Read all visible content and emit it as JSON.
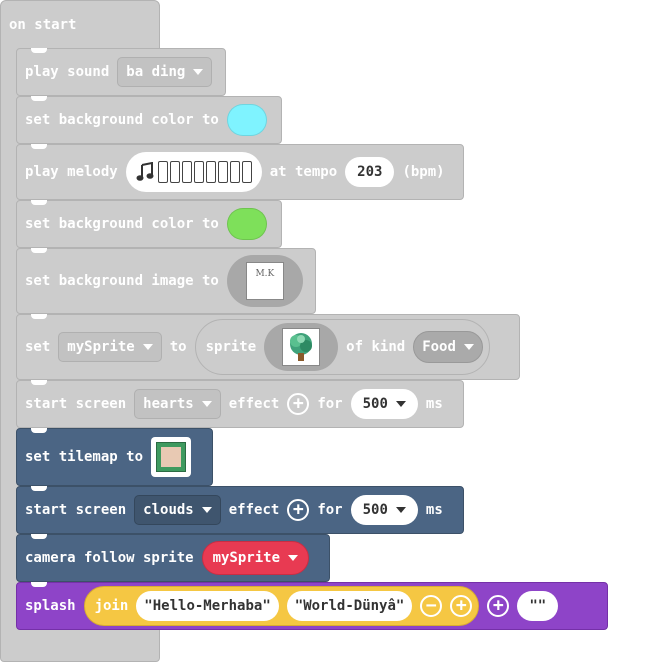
{
  "on_start": {
    "label": "on start"
  },
  "play_sound": {
    "label": "play sound",
    "sound": "ba ding"
  },
  "bg_color_1": {
    "label": "set background color to",
    "color": "#7ff3ff"
  },
  "play_melody": {
    "label": "play melody",
    "at_tempo": "at tempo",
    "tempo": "203",
    "unit": "(bpm)",
    "note_icon": "music-note-icon"
  },
  "bg_color_2": {
    "label": "set background color to",
    "color": "#7ee05a"
  },
  "bg_image": {
    "label": "set background image to",
    "thumb_text": "M.K"
  },
  "set_sprite": {
    "label": "set",
    "variable": "mySprite",
    "to": "to",
    "sprite": "sprite",
    "of_kind": "of kind",
    "kind": "Food"
  },
  "screen_effect_1": {
    "label": "start screen",
    "effect": "hearts",
    "effect_label": "effect",
    "for": "for",
    "duration": "500",
    "unit": "ms"
  },
  "set_tilemap": {
    "label": "set tilemap to"
  },
  "screen_effect_2": {
    "label": "start screen",
    "effect": "clouds",
    "effect_label": "effect",
    "for": "for",
    "duration": "500",
    "unit": "ms"
  },
  "camera_follow": {
    "label": "camera follow sprite",
    "variable": "mySprite"
  },
  "splash": {
    "label": "splash",
    "join": "join",
    "text1": "Hello-Merhaba",
    "text2": " World-Dünyâ",
    "text3": ""
  },
  "colors": {
    "gray_block": "#cccccc",
    "blue_block": "#4b6584",
    "purple_block": "#8e44c8",
    "variable_red": "#e83a52",
    "join_yellow": "#f5c743"
  }
}
